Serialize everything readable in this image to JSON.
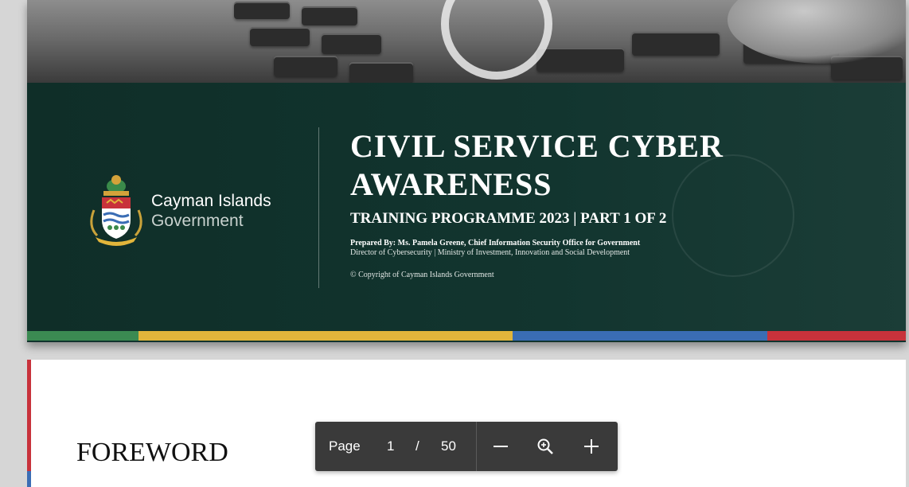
{
  "cover": {
    "org_name": "Cayman Islands",
    "org_sub": "Government",
    "title_line1": "CIVIL SERVICE CYBER",
    "title_line2": "AWARENESS",
    "subtitle": "TRAINING PROGRAMME 2023 | PART 1 OF 2",
    "prepared_by": "Prepared By: Ms. Pamela Greene, Chief Information Security Office for Government",
    "director": "Director of Cybersecurity | Ministry of Investment, Innovation and Social Development",
    "copyright": "© Copyright of Cayman Islands Government",
    "stripe_colors": [
      "#3b8a52",
      "#e2b53b",
      "#3a6db4",
      "#c8323b"
    ]
  },
  "page2": {
    "heading": "FOREWORD"
  },
  "toolbar": {
    "page_label": "Page",
    "current_page": "1",
    "separator": "/",
    "total_pages": "50",
    "zoom_out_icon": "minus-icon",
    "zoom_icon": "zoom-icon",
    "zoom_in_icon": "plus-icon"
  }
}
